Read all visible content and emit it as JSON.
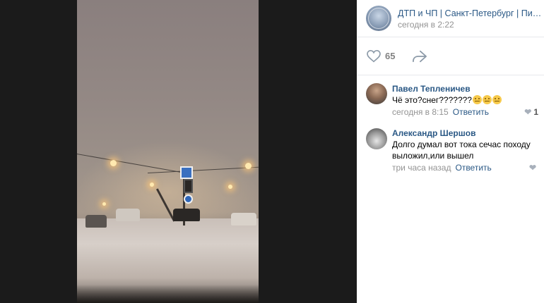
{
  "post": {
    "group_name": "ДТП и ЧП | Санкт-Петербург | Питер онлайн | СПб",
    "time": "сегодня в 2:22",
    "likes": "65"
  },
  "comments": [
    {
      "author": "Павел Тепленичев",
      "text": "Чё это?снег???????",
      "emoji_count": 3,
      "date": "сегодня в 8:15",
      "reply": "Ответить",
      "likes": "1"
    },
    {
      "author": "Александр Шершов",
      "text": "Долго думал вот тока сечас походу выложил,или вышел",
      "date": "три часа назад",
      "reply": "Ответить",
      "likes": ""
    }
  ],
  "icons": {
    "like": "heart-icon",
    "share": "share-arrow-icon",
    "comment_like": "heart-icon"
  },
  "colors": {
    "link": "#2a5885",
    "muted": "#939393",
    "viewer_bg": "#1b1b1b"
  }
}
